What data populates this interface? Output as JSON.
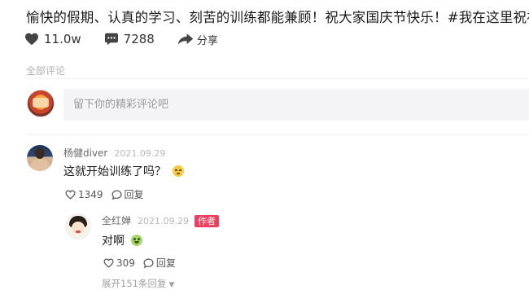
{
  "post": {
    "text": "愉快的假期、认真的学习、刻苦的训练都能兼顾！祝大家国庆节快乐！#我在这里祝福祖国"
  },
  "stats": {
    "likes": "11.0w",
    "comments": "7288",
    "share_label": "分享"
  },
  "comments_section": {
    "label": "全部评论",
    "input_placeholder": "留下你的精彩评论吧"
  },
  "comments": [
    {
      "username": "杨健diver",
      "time": "2021.09.29",
      "text": "这就开始训练了吗？",
      "emoji": "sleepy-emoji",
      "likes": "1349",
      "reply_label": "回复",
      "replies": [
        {
          "username": "全红婵",
          "time": "2021.09.29",
          "badge": "作者",
          "text": "对啊",
          "emoji": "smile-emoji",
          "likes": "309",
          "reply_label": "回复"
        }
      ],
      "expand_label": "展开151条回复"
    }
  ],
  "colors": {
    "author_badge": "#f03f5e",
    "input_bg": "#f4f4f6",
    "muted_text": "#b0b0b0"
  }
}
